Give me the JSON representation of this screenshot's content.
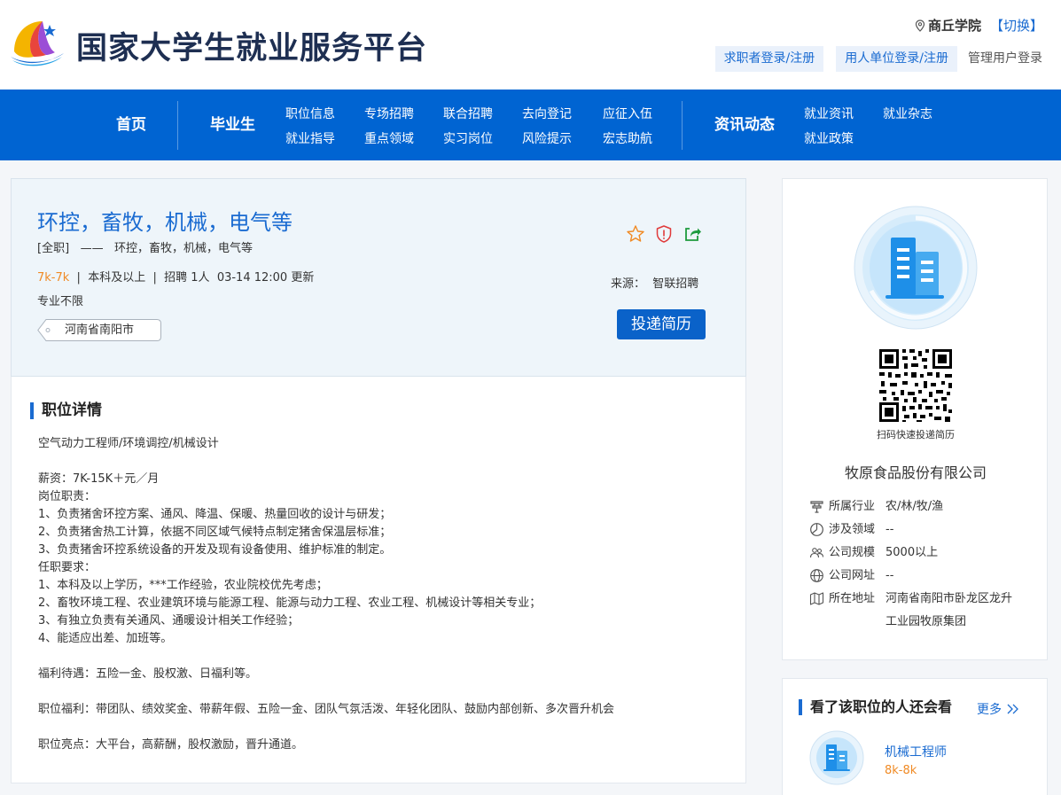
{
  "header": {
    "site_title": "国家大学生就业服务平台",
    "location": "商丘学院",
    "switch_label": "【切换】",
    "login_seeker": "求职者登录/注册",
    "login_employer": "用人单位登录/注册",
    "login_admin": "管理用户登录"
  },
  "nav": {
    "home": "首页",
    "graduate": "毕业生",
    "items_row1": [
      "职位信息",
      "专场招聘",
      "联合招聘",
      "去向登记",
      "应征入伍"
    ],
    "items_row2": [
      "就业指导",
      "重点领域",
      "实习岗位",
      "风险提示",
      "宏志助航"
    ],
    "news": "资讯动态",
    "news_row1": [
      "就业资讯",
      "就业杂志"
    ],
    "news_row2": [
      "就业政策"
    ]
  },
  "job": {
    "title": "环控，畜牧，机械，电气等",
    "type": "[全职]",
    "dash": "——",
    "subtitle": "环控，畜牧，机械，电气等",
    "salary": "7k-7k",
    "education": "本科及以上",
    "headcount": "招聘 1人",
    "updated": "03-14 12:00 更新",
    "major": "专业不限",
    "location_tag": "河南省南阳市",
    "source_label": "来源：",
    "source": "智联招聘",
    "apply_label": "投递简历"
  },
  "details": {
    "title": "职位详情",
    "lines": [
      "空气动力工程师/环境调控/机械设计",
      "",
      "薪资：7K-15K＋元／月",
      "岗位职责：",
      "1、负责猪舍环控方案、通风、降温、保暖、热量回收的设计与研发；",
      "2、负责猪舍热工计算，依据不同区域气候特点制定猪舍保温层标准；",
      "3、负责猪舍环控系统设备的开发及现有设备使用、维护标准的制定。",
      "任职要求：",
      "1、本科及以上学历，***工作经验，农业院校优先考虑；",
      "2、畜牧环境工程、农业建筑环境与能源工程、能源与动力工程、农业工程、机械设计等相关专业；",
      "3、有独立负责有关通风、通暖设计相关工作经验；",
      "4、能适应出差、加班等。",
      "",
      "福利待遇：五险一金、股权激、日福利等。",
      "",
      "职位福利：带团队、绩效奖金、带薪年假、五险一金、团队气氛活泼、年轻化团队、鼓励内部创新、多次晋升机会",
      "",
      "职位亮点：大平台，高薪酬，股权激励，晋升通道。"
    ]
  },
  "company": {
    "qr_caption": "扫码快速投递简历",
    "name": "牧原食品股份有限公司",
    "industry_label": "所属行业",
    "industry": "农/林/牧/渔",
    "field_label": "涉及领域",
    "field": "--",
    "scale_label": "公司规模",
    "scale": "5000以上",
    "website_label": "公司网址",
    "website": "--",
    "address_label": "所在地址",
    "address": "河南省南阳市卧龙区龙升工业园牧原集团"
  },
  "recommend": {
    "title": "看了该职位的人还会看",
    "more": "更多",
    "job": "机械工程师",
    "salary": "8k-8k"
  },
  "colors": {
    "brand_blue": "#0064d2",
    "link_blue": "#1a6bd1",
    "salary_orange": "#f08a24"
  }
}
